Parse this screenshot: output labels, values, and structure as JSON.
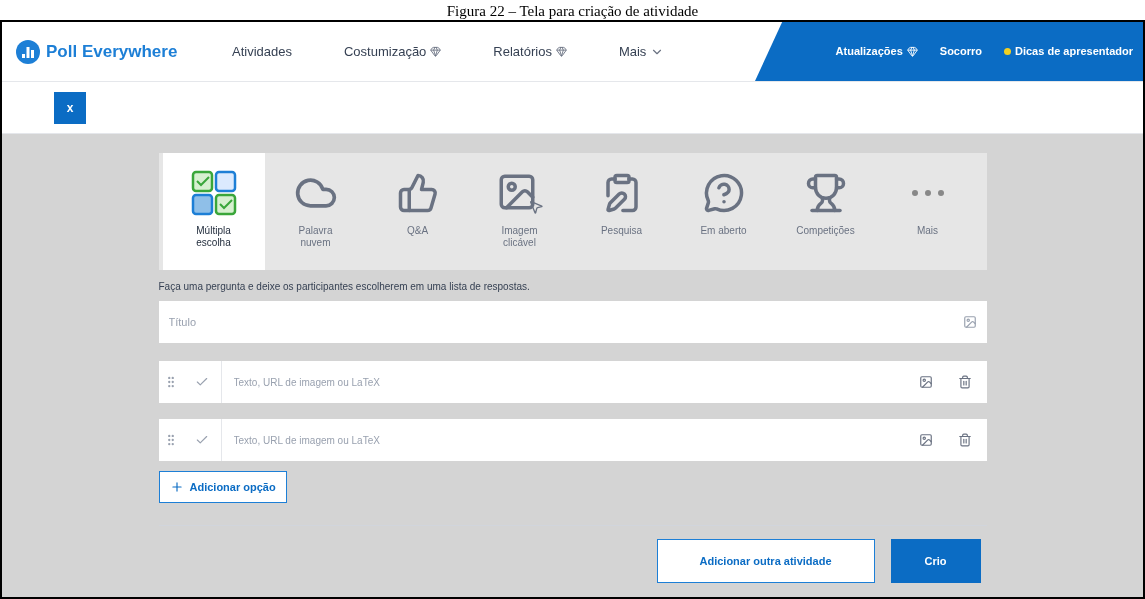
{
  "caption": "Figura 22 – Tela para criação de atividade",
  "nav": {
    "brand": "Poll Everywhere",
    "items": [
      {
        "label": "Atividades",
        "kind": "plain"
      },
      {
        "label": "Costumização",
        "kind": "premium"
      },
      {
        "label": "Relatórios",
        "kind": "premium"
      },
      {
        "label": "Mais",
        "kind": "menu"
      }
    ],
    "right_items": [
      {
        "label": "Atualizações",
        "kind": "premium"
      },
      {
        "label": "Socorro",
        "kind": "plain"
      },
      {
        "label": "Dicas de apresentador",
        "kind": "dot"
      }
    ]
  },
  "close_button": "x",
  "activity_types": [
    {
      "label": "Múltipla escolha",
      "kind": "choice",
      "selected": true
    },
    {
      "label": "Palavra nuvem",
      "kind": "cloud",
      "selected": false
    },
    {
      "label": "Q&A",
      "kind": "thumbs",
      "selected": false
    },
    {
      "label": "Imagem clicável",
      "kind": "image",
      "selected": false
    },
    {
      "label": "Pesquisa",
      "kind": "survey",
      "selected": false
    },
    {
      "label": "Em aberto",
      "kind": "question",
      "selected": false
    },
    {
      "label": "Competições",
      "kind": "trophy",
      "selected": false
    },
    {
      "label": "Mais",
      "kind": "more",
      "selected": false
    }
  ],
  "description": "Faça uma pergunta e deixe os participantes escolherem em uma lista de respostas.",
  "title_field": {
    "placeholder": "Título"
  },
  "options": [
    {
      "placeholder": "Texto, URL de imagem ou LaTeX"
    },
    {
      "placeholder": "Texto, URL de imagem ou LaTeX"
    }
  ],
  "add_option": "Adicionar opção",
  "actions": {
    "secondary": "Adicionar outra atividade",
    "primary": "Crio"
  }
}
